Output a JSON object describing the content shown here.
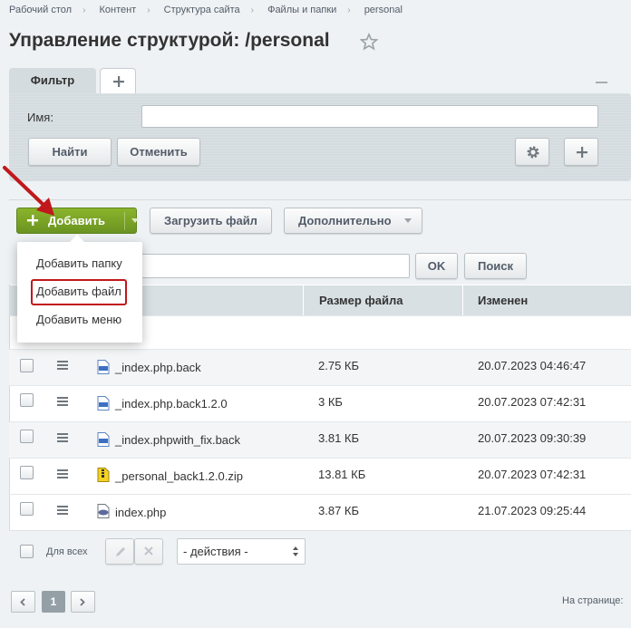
{
  "breadcrumb": [
    "Рабочий стол",
    "Контент",
    "Структура сайта",
    "Файлы и папки",
    "personal"
  ],
  "page_title": "Управление структурой: /personal",
  "filter": {
    "tab_label": "Фильтр",
    "name_label": "Имя:",
    "name_value": "",
    "find_label": "Найти",
    "cancel_label": "Отменить"
  },
  "toolbar": {
    "add_label": "Добавить",
    "upload_label": "Загрузить файл",
    "more_label": "Дополнительно",
    "search_value": "",
    "ok_label": "OK",
    "search_label": "Поиск"
  },
  "add_menu": {
    "items": [
      "Добавить папку",
      "Добавить файл",
      "Добавить меню"
    ],
    "highlighted": "Добавить файл"
  },
  "table": {
    "columns": [
      "Размер файла",
      "Изменен"
    ],
    "rows": [
      {
        "name": "_index.php.back",
        "size": "2.75 КБ",
        "modified": "20.07.2023 04:46:47",
        "icon": "file-icon"
      },
      {
        "name": "_index.php.back1.2.0",
        "size": "3 КБ",
        "modified": "20.07.2023 07:42:31",
        "icon": "file-icon"
      },
      {
        "name": "_index.phpwith_fix.back",
        "size": "3.81 КБ",
        "modified": "20.07.2023 09:30:39",
        "icon": "file-icon"
      },
      {
        "name": "_personal_back1.2.0.zip",
        "size": "13.81 КБ",
        "modified": "20.07.2023 07:42:31",
        "icon": "zip-icon"
      },
      {
        "name": "index.php",
        "size": "3.87 КБ",
        "modified": "21.07.2023 09:25:44",
        "icon": "php-icon"
      }
    ]
  },
  "footer": {
    "select_all_label": "Для всех",
    "actions_value": "- действия -"
  },
  "pager": {
    "current_page": "1",
    "per_page_label": "На странице:"
  },
  "colors": {
    "add_button": "#7aa52a",
    "highlight_border": "#c0181c",
    "table_header": "#d8e0e3"
  }
}
